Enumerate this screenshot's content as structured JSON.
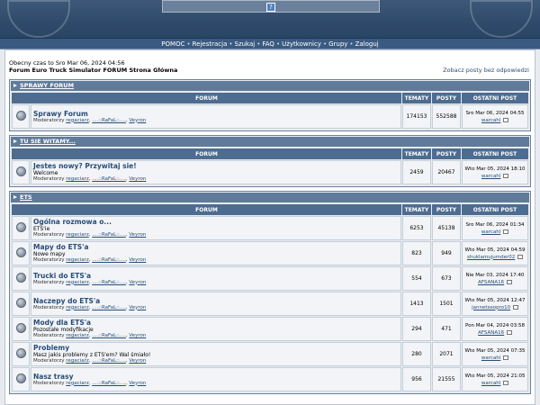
{
  "header": {
    "nav": [
      "POMOC",
      "Rejestracja",
      "Szukaj",
      "FAQ",
      "Użytkownicy",
      "Grupy",
      "Zaloguj"
    ]
  },
  "info": {
    "current_time": "Obecny czas to Sro Mar 06, 2024 04:56",
    "home": "Forum Euro Truck Simulator FORUM Strona Główna",
    "unanswered": "Zobacz posty bez odpowiedzi"
  },
  "columns": {
    "forum": "FORUM",
    "topics": "TEMATY",
    "posts": "POSTY",
    "last_post": "OSTATNI POST"
  },
  "categories": [
    {
      "title": "SPRAWY FORUM",
      "forums": [
        {
          "name": "Sprawy Forum",
          "desc": "",
          "mods_label": "Moderatorzy",
          "mods": [
            "regaciarz",
            "....::RaFaL::....",
            "Veyron"
          ],
          "topics": "174153",
          "posts": "552588",
          "last_date": "Sro Mar 06, 2024 04:55",
          "last_user": "warcahl"
        }
      ]
    },
    {
      "title": "TU SIE WITAMY...",
      "forums": [
        {
          "name": "Jestes nowy? Przywitaj sie!",
          "desc": "Welcome",
          "mods_label": "Moderatorzy",
          "mods": [
            "regaciarz",
            "....::RaFaL::....",
            "Veyron"
          ],
          "topics": "2459",
          "posts": "20467",
          "last_date": "Wto Mar 05, 2024 18:10",
          "last_user": "warcahl"
        }
      ]
    },
    {
      "title": "ETS",
      "forums": [
        {
          "name": "Ogólna rozmowa o...",
          "desc": "ETS'ie",
          "mods_label": "Moderatorzy",
          "mods": [
            "regaciarz",
            "....::RaFaL::....",
            "Veyron"
          ],
          "topics": "6253",
          "posts": "45138",
          "last_date": "Sro Mar 06, 2024 01:34",
          "last_user": "warcahl"
        },
        {
          "name": "Mapy do ETS'a",
          "desc": "Nowe mapy",
          "mods_label": "Moderatorzy",
          "mods": [
            "regaciarz",
            "....::RaFaL::....",
            "Veyron"
          ],
          "topics": "823",
          "posts": "949",
          "last_date": "Wto Mar 05, 2024 04:59",
          "last_user": "shuklamujumder02"
        },
        {
          "name": "Trucki do ETS'a",
          "desc": "",
          "mods_label": "Moderatorzy",
          "mods": [
            "regaciarz",
            "....::RaFaL::....",
            "Veyron"
          ],
          "topics": "554",
          "posts": "673",
          "last_date": "Nie Mar 03, 2024 17:40",
          "last_user": "AFSANA16"
        },
        {
          "name": "Naczepy do ETS'a",
          "desc": "",
          "mods_label": "Moderatorzy",
          "mods": [
            "regaciarz",
            "....::RaFaL::....",
            "Veyron"
          ],
          "topics": "1413",
          "posts": "1501",
          "last_date": "Wto Mar 05, 2024 12:47",
          "last_user": "jannetseopro10"
        },
        {
          "name": "Mody dla ETS'a",
          "desc": "Pozostałe modyfikacje",
          "mods_label": "Moderatorzy",
          "mods": [
            "regaciarz",
            "....::RaFaL::....",
            "Veyron"
          ],
          "topics": "294",
          "posts": "471",
          "last_date": "Pon Mar 04, 2024 03:58",
          "last_user": "AFSANA16"
        },
        {
          "name": "Problemy",
          "desc": "Masz jakis problemy z ETS'em? Wal śmiało!",
          "mods_label": "Moderatorzy",
          "mods": [
            "regaciarz",
            "....::RaFaL::....",
            "Veyron"
          ],
          "topics": "280",
          "posts": "2071",
          "last_date": "Wto Mar 05, 2024 07:35",
          "last_user": "warcahl"
        },
        {
          "name": "Nasz trasy",
          "desc": "",
          "mods_label": "Moderatorzy",
          "mods": [
            "regaciarz",
            "....::RaFaL::....",
            "Veyron"
          ],
          "topics": "956",
          "posts": "21555",
          "last_date": "Wto Mar 05, 2024 21:05",
          "last_user": "warcahl"
        }
      ]
    }
  ]
}
